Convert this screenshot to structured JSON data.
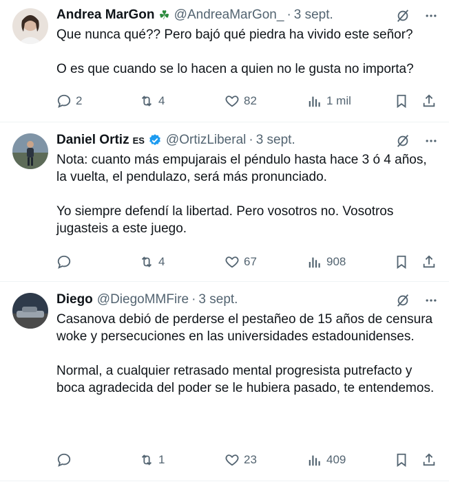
{
  "tweets": [
    {
      "name": "Andrea MarGon",
      "handle": "@AndreaMarGon_",
      "separator": "·",
      "date": "3 sept.",
      "text": "Que nunca qué?? Pero bajó qué piedra ha vivido este señor?\n\nO es que cuando se lo hacen a quien no le gusta no importa?",
      "replies": "2",
      "retweets": "4",
      "likes": "82",
      "views": "1 mil"
    },
    {
      "name": "Daniel Ortiz",
      "name_tag": "ES",
      "handle": "@OrtizLiberal",
      "separator": "·",
      "date": "3 sept.",
      "text": "Nota: cuanto más empujarais el péndulo hasta hace 3 ó 4 años, la vuelta, el pendulazo, será más pronunciado.\n\nYo siempre defendí la libertad. Pero vosotros no. Vosotros jugasteis a este juego.",
      "replies": "",
      "retweets": "4",
      "likes": "67",
      "views": "908"
    },
    {
      "name": "Diego",
      "handle": "@DiegoMMFire",
      "separator": "·",
      "date": "3 sept.",
      "text": "Casanova debió de perderse el pestañeo de 15 años de censura woke y persecuciones en las universidades estadounidenses.\n\nNormal, a cualquier retrasado mental progresista putrefacto y boca agradecida del poder se le hubiera pasado, te entendemos.",
      "replies": "",
      "retweets": "1",
      "likes": "23",
      "views": "409"
    }
  ],
  "icons": {
    "clover": "shamrock-icon",
    "verified": "verified-badge-icon",
    "grok": "grok-icon",
    "more": "more-icon",
    "reply": "reply-icon",
    "retweet": "retweet-icon",
    "like": "heart-icon",
    "views": "views-icon",
    "bookmark": "bookmark-icon",
    "share": "share-icon"
  },
  "colors": {
    "text": "#0f1419",
    "muted": "#536471",
    "verified": "#1d9bf0",
    "divider": "#eff3f4"
  }
}
